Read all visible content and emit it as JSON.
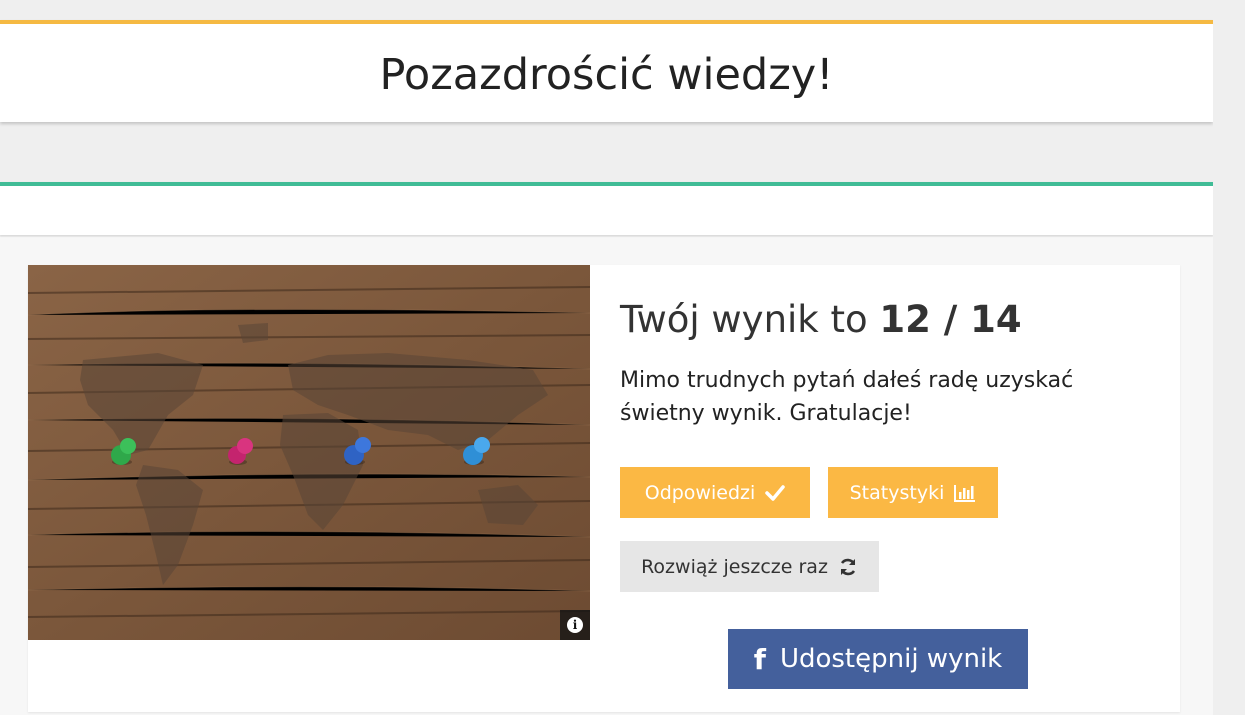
{
  "header": {
    "title": "Pozazdrościć wiedzy!"
  },
  "result": {
    "score_prefix": "Twój wynik to ",
    "score_value": "12 / 14",
    "message": "Mimo trudnych pytań dałeś radę uzyskać świetny wynik. Gratulacje!"
  },
  "buttons": {
    "answers_label": "Odpowiedzi",
    "answers_icon": "check-icon",
    "stats_label": "Statystyki",
    "stats_icon": "bar-chart-icon",
    "retry_label": "Rozwiąż jeszcze raz",
    "retry_icon": "refresh-icon",
    "share_label": "Udostępnij wynik",
    "share_icon": "facebook-icon"
  },
  "image": {
    "description_icon": "info-icon",
    "pins": [
      "green",
      "magenta",
      "blue",
      "light-blue"
    ]
  },
  "colors": {
    "accent_orange": "#fbb844",
    "accent_green": "#40bc96",
    "header_border": "#f5b942",
    "facebook_blue": "#44609c",
    "retry_gray": "#e6e6e6"
  }
}
